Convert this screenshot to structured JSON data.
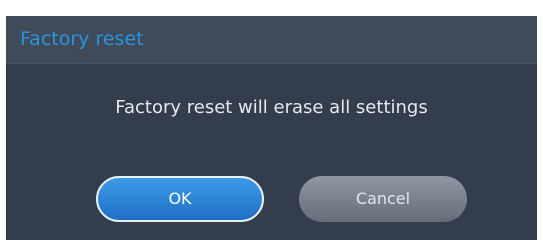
{
  "dialog": {
    "title": "Factory reset",
    "message": "Factory reset will erase all settings",
    "buttons": {
      "ok_label": "OK",
      "cancel_label": "Cancel"
    }
  },
  "colors": {
    "title_accent": "#2a93e0",
    "dialog_background": "#333d4b",
    "ok_button": "#2f86d8",
    "cancel_button": "#7a828e"
  }
}
